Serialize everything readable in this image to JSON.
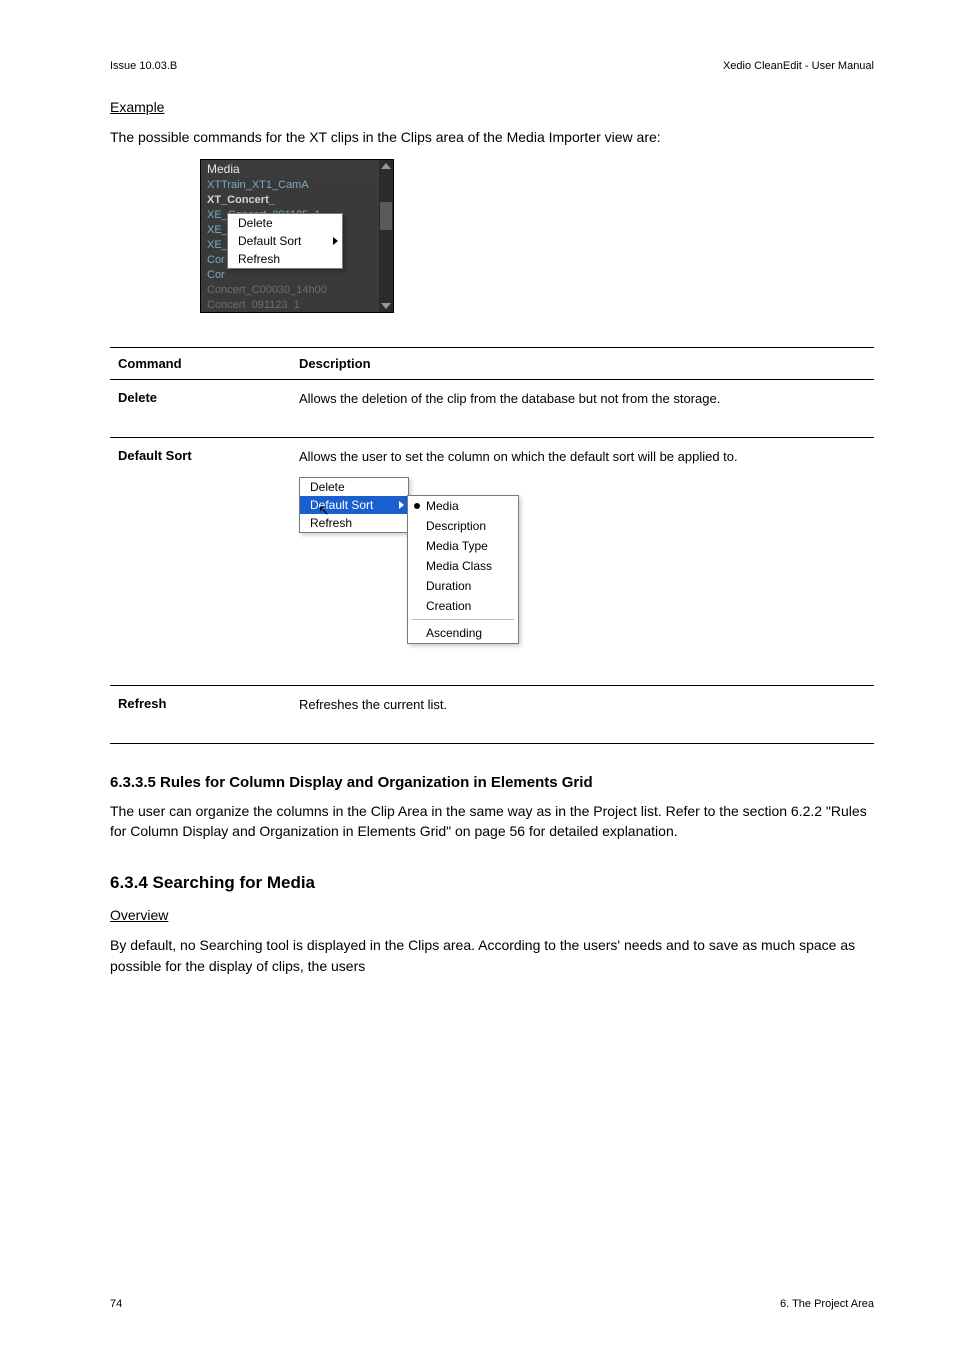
{
  "header": {
    "issue": "Issue 10.03.B",
    "manual": "Xedio CleanEdit - User Manual"
  },
  "sec_example_heading": "Example",
  "sec_example_text": "The possible commands for the XT clips in the Clips area of the Media Importer view are:",
  "fig1": {
    "header": "Media",
    "rows": [
      "XTTrain_XT1_CamA",
      "XT_Concert_",
      "XE_Concert_091125_1",
      "XE_",
      "XE_",
      "Cor",
      "Cor",
      "Concert_C00030_14h00",
      "Concert_091123_1"
    ],
    "menu": {
      "delete": "Delete",
      "default_sort": "Default Sort",
      "refresh": "Refresh"
    }
  },
  "commands": {
    "head_command": "Command",
    "head_description": "Description",
    "rows": [
      {
        "cmd": "Delete",
        "desc": "Allows the deletion of the clip from the database but not from the storage."
      },
      {
        "cmd": "Default Sort",
        "desc": "Allows the user to set the column on which the default sort will be applied to."
      },
      {
        "cmd": "Refresh",
        "desc": "Refreshes the current list."
      }
    ]
  },
  "fig2": {
    "menu": {
      "delete": "Delete",
      "default_sort": "Default Sort",
      "refresh": "Refresh"
    },
    "submenu": {
      "media": "Media",
      "description": "Description",
      "media_type": "Media Type",
      "media_class": "Media Class",
      "duration": "Duration",
      "creation": "Creation",
      "ascending": "Ascending"
    }
  },
  "sec_rules_heading": "6.3.3.5 Rules for Column Display and Organization in Elements Grid",
  "sec_rules_text": "The user can organize the columns in the Clip Area in the same way as in the Project list. Refer to the section 6.2.2 \"Rules for Column Display and Organization in Elements Grid\" on page 56 for detailed explanation.",
  "sec_search_heading": "6.3.4 Searching for Media",
  "sec_search_sub": "Overview",
  "sec_search_text": "By default, no Searching tool is displayed in the Clips area. According to the users' needs and to save as much space as possible for the display of clips, the users",
  "footer": {
    "page": "74",
    "chapter": "6. The Project Area"
  }
}
